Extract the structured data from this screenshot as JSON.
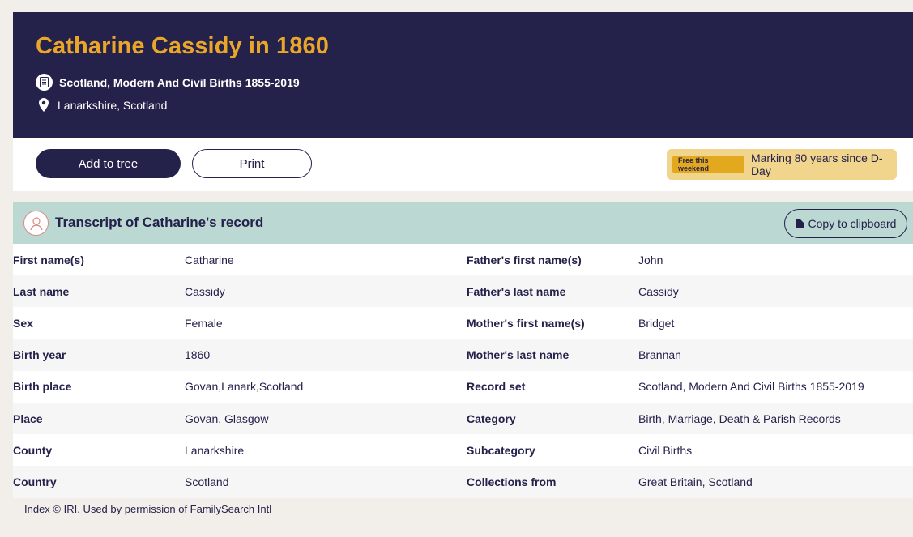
{
  "header": {
    "title": "Catharine Cassidy in 1860",
    "collection": "Scotland, Modern And Civil Births 1855-2019",
    "location": "Lanarkshire, Scotland"
  },
  "toolbar": {
    "add_label": "Add to tree",
    "print_label": "Print",
    "promo_badge": "Free this weekend",
    "promo_text": "Marking 80 years since D-Day"
  },
  "transcript": {
    "title": "Transcript of Catharine's record",
    "copy_label": "Copy to clipboard"
  },
  "rows": [
    {
      "label1": "First name(s)",
      "value1": "Catharine",
      "label2": "Father's first name(s)",
      "value2": "John"
    },
    {
      "label1": "Last name",
      "value1": "Cassidy",
      "label2": "Father's last name",
      "value2": "Cassidy"
    },
    {
      "label1": "Sex",
      "value1": "Female",
      "label2": "Mother's first name(s)",
      "value2": "Bridget"
    },
    {
      "label1": "Birth year",
      "value1": "1860",
      "label2": "Mother's last name",
      "value2": "Brannan"
    },
    {
      "label1": "Birth place",
      "value1": "Govan,Lanark,Scotland",
      "label2": "Record set",
      "value2": "Scotland, Modern And Civil Births 1855-2019"
    },
    {
      "label1": "Place",
      "value1": "Govan, Glasgow",
      "label2": "Category",
      "value2": "Birth, Marriage, Death & Parish Records"
    },
    {
      "label1": "County",
      "value1": "Lanarkshire",
      "label2": "Subcategory",
      "value2": "Civil Births"
    },
    {
      "label1": "Country",
      "value1": "Scotland",
      "label2": "Collections from",
      "value2": "Great Britain, Scotland"
    }
  ],
  "footer": {
    "credit": "Index © IRI. Used by permission of FamilySearch Intl"
  },
  "colors": {
    "header_bg": "#24214a",
    "title_accent": "#e9a62b",
    "transcript_bg": "#bcd8d3",
    "promo_bg": "#f1d58d"
  }
}
